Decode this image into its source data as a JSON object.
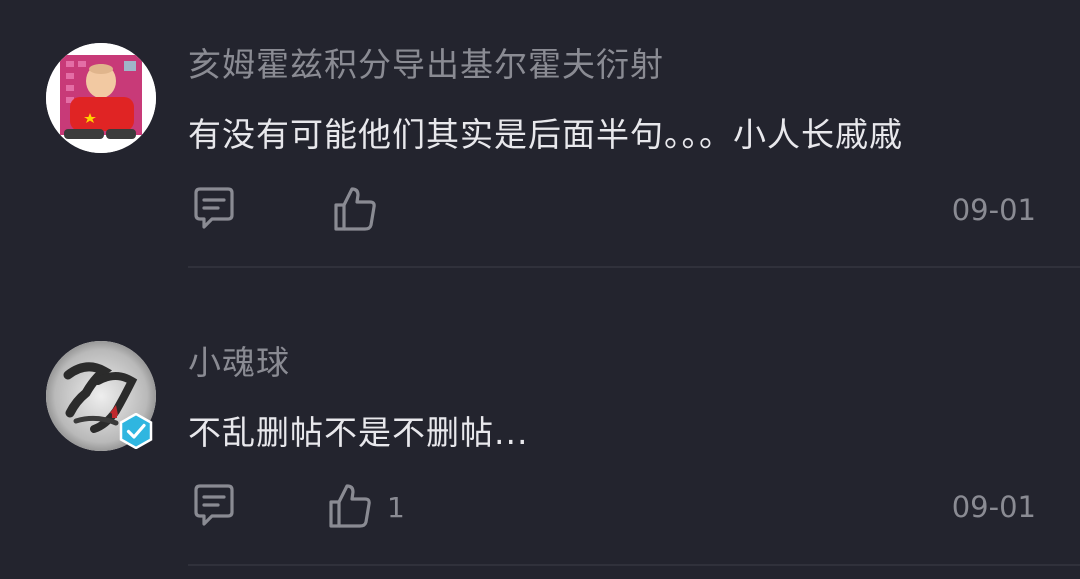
{
  "comments": [
    {
      "username": "亥姆霍兹积分导出基尔霍夫衍射",
      "content": "有没有可能他们其实是后面半句。。。小人长戚戚",
      "like_count": "",
      "timestamp": "09-01"
    },
    {
      "username": "小魂球",
      "content": "不乱删帖不是不删帖...",
      "like_count": "1",
      "timestamp": "09-01"
    }
  ],
  "icons": {
    "reply": "comment-bubble-icon",
    "like": "thumbs-up-icon",
    "verified": "verified-check-icon"
  },
  "colors": {
    "background": "#23242e",
    "primary_text": "#e8e8ec",
    "secondary_text": "#8a8b93",
    "divider": "#30313b",
    "verified_badge": "#2fb6e0"
  }
}
